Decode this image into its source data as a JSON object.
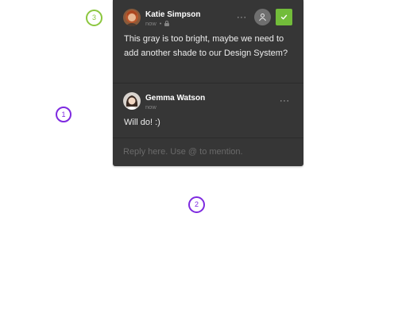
{
  "pins": [
    {
      "label": "1",
      "color": "#7e2ae0"
    },
    {
      "label": "2",
      "color": "#7e2ae0"
    },
    {
      "label": "3",
      "color": "#8cc73f"
    }
  ],
  "thread": {
    "resolve_color": "#72bc3a",
    "comments": [
      {
        "author": "Katie Simpson",
        "time": "now",
        "privacy_icon": "lock-icon",
        "text": "This gray is too bright, maybe we need to add another shade to our Design System?",
        "more": "···"
      },
      {
        "author": "Gemma Watson",
        "time": "now",
        "text": "Will do! :)",
        "more": "···"
      }
    ],
    "reply_placeholder": "Reply here. Use @ to mention."
  }
}
